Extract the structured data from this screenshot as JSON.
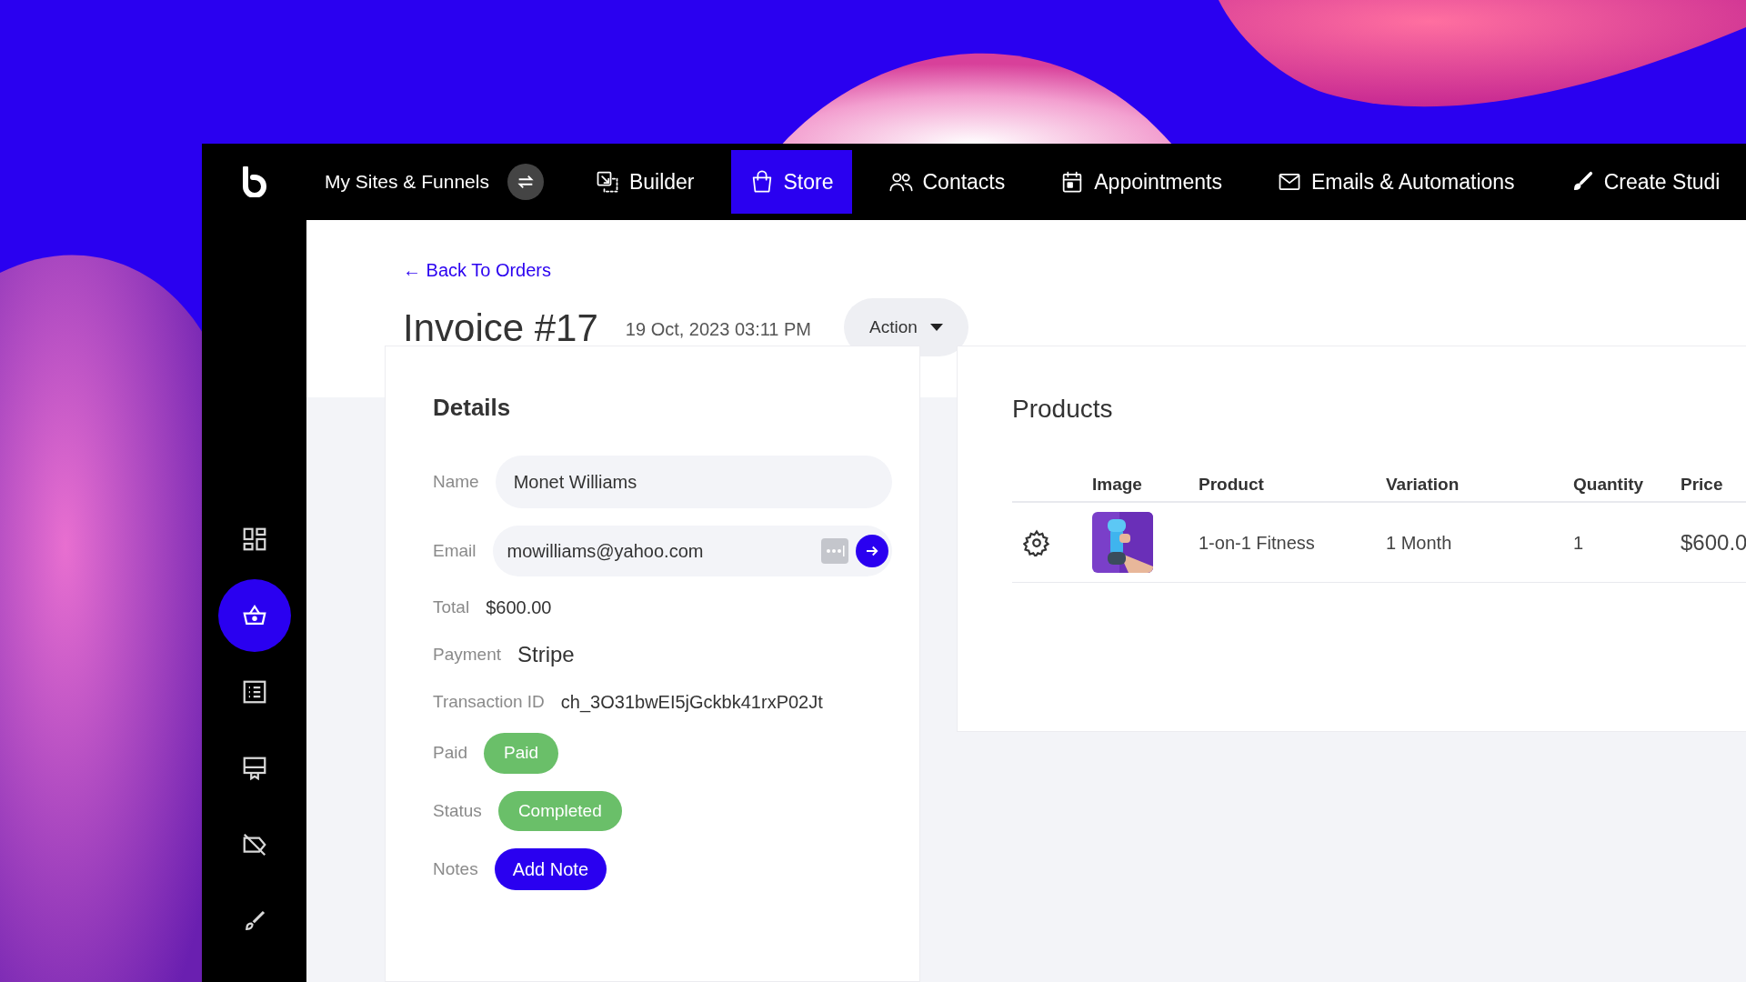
{
  "topbar": {
    "site_switcher": "My Sites & Funnels",
    "nav": [
      {
        "kind": "builder",
        "label": "Builder",
        "selected": false
      },
      {
        "kind": "store",
        "label": "Store",
        "selected": true
      },
      {
        "kind": "contacts",
        "label": "Contacts",
        "selected": false
      },
      {
        "kind": "appointments",
        "label": "Appointments",
        "selected": false
      },
      {
        "kind": "emails",
        "label": "Emails & Automations",
        "selected": false
      },
      {
        "kind": "studio",
        "label": "Create Studi",
        "selected": false
      }
    ]
  },
  "sidebar": {
    "items": [
      {
        "kind": "grid",
        "selected": false
      },
      {
        "kind": "basket",
        "selected": true
      },
      {
        "kind": "list",
        "selected": false
      },
      {
        "kind": "monitor",
        "selected": false
      },
      {
        "kind": "tag",
        "selected": false
      },
      {
        "kind": "brush",
        "selected": false
      }
    ]
  },
  "header": {
    "back_link": "← Back To Orders",
    "title": "Invoice #17",
    "date": "19 Oct, 2023 03:11 PM",
    "action_button": "Action"
  },
  "details": {
    "title": "Details",
    "fields": [
      {
        "kind": "input",
        "label": "Name",
        "value": "Monet Williams"
      },
      {
        "kind": "email",
        "label": "Email",
        "value": "mowilliams@yahoo.com"
      },
      {
        "kind": "text",
        "label": "Total",
        "value": "$600.00"
      },
      {
        "kind": "large_text",
        "label": "Payment",
        "value": "Stripe"
      },
      {
        "kind": "text",
        "label": "Transaction ID",
        "value": "ch_3O31bwEI5jGckbk41rxP02Jt"
      },
      {
        "kind": "badge",
        "label": "Paid",
        "value": "Paid",
        "color": "#6abf69"
      },
      {
        "kind": "badge",
        "label": "Status",
        "value": "Completed",
        "color": "#6abf69"
      },
      {
        "kind": "button",
        "label": "Notes",
        "value": "Add Note"
      }
    ]
  },
  "products": {
    "title": "Products",
    "columns": [
      "Image",
      "Product",
      "Variation",
      "Quantity",
      "Price"
    ],
    "rows": [
      {
        "product": "1-on-1 Fitness",
        "variation": "1 Month",
        "quantity": "1",
        "price": "$600.0"
      }
    ]
  }
}
